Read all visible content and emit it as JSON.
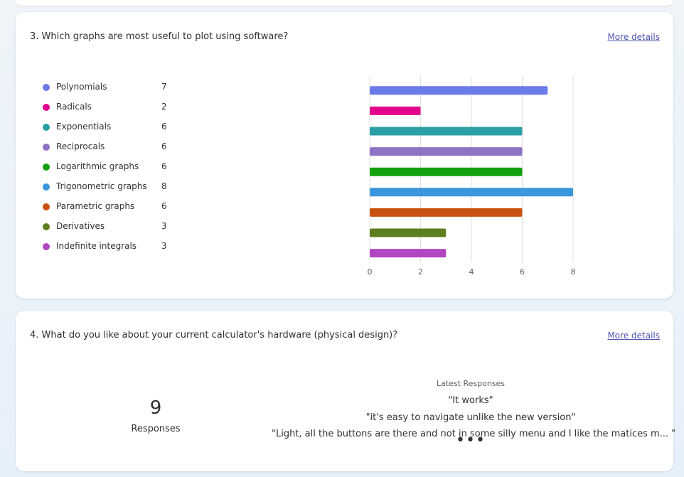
{
  "question3": {
    "title": "3. Which graphs are most useful to plot using software?",
    "more_details": "More details",
    "legend": [
      {
        "label": "Polynomials",
        "count": "7",
        "color": "#6b7be8"
      },
      {
        "label": "Radicals",
        "count": "2",
        "color": "#e3008c"
      },
      {
        "label": "Exponentials",
        "count": "6",
        "color": "#2aa0a4"
      },
      {
        "label": "Reciprocals",
        "count": "6",
        "color": "#8e72c4"
      },
      {
        "label": "Logarithmic graphs",
        "count": "6",
        "color": "#13a10e"
      },
      {
        "label": "Trigonometric graphs",
        "count": "8",
        "color": "#3a96dd"
      },
      {
        "label": "Parametric graphs",
        "count": "6",
        "color": "#ca5010"
      },
      {
        "label": "Derivatives",
        "count": "3",
        "color": "#5c7e1f"
      },
      {
        "label": "Indefinite integrals",
        "count": "3",
        "color": "#b146c2"
      }
    ]
  },
  "chart_data": {
    "type": "bar",
    "orientation": "horizontal",
    "categories": [
      "Polynomials",
      "Radicals",
      "Exponentials",
      "Reciprocals",
      "Logarithmic graphs",
      "Trigonometric graphs",
      "Parametric graphs",
      "Derivatives",
      "Indefinite integrals"
    ],
    "values": [
      7,
      2,
      6,
      6,
      6,
      8,
      6,
      3,
      3
    ],
    "colors": [
      "#6b7be8",
      "#e3008c",
      "#2aa0a4",
      "#8e72c4",
      "#13a10e",
      "#3a96dd",
      "#ca5010",
      "#5c7e1f",
      "#b146c2"
    ],
    "xlim": [
      0,
      8
    ],
    "xticks": [
      "0",
      "2",
      "4",
      "6",
      "8"
    ],
    "grid": true,
    "title": "",
    "xlabel": "",
    "ylabel": ""
  },
  "question4": {
    "title": "4. What do you like about your current calculator's hardware (physical design)?",
    "more_details": "More details",
    "response_count": "9",
    "responses_label": "Responses",
    "latest_heading": "Latest Responses",
    "latest": [
      "\"It works\"",
      "\"it's easy to navigate unlike the new version\"",
      "\"Light, all the buttons are there and not in some silly menu and I like the matices m... \""
    ],
    "more_glyph": "•••"
  }
}
